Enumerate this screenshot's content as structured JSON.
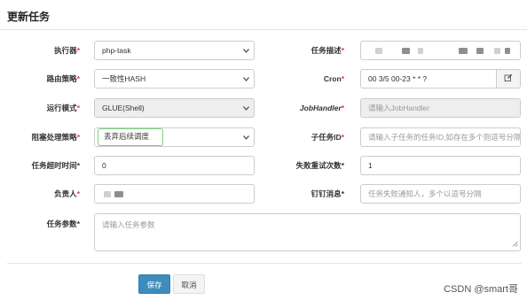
{
  "dialog": {
    "title": "更新任务"
  },
  "form": {
    "executor": {
      "label": "执行器",
      "value": "php-task"
    },
    "desc": {
      "label": "任务描述"
    },
    "route": {
      "label": "路由策略",
      "value": "一致性HASH"
    },
    "cron": {
      "label": "Cron",
      "value": "00 3/5 00-23 * * ?"
    },
    "run_mode": {
      "label": "运行模式",
      "value": "GLUE(Shell)"
    },
    "job_handler": {
      "label": "JobHandler",
      "placeholder": "请输入JobHandler"
    },
    "block_strategy": {
      "label": "阻塞处理策略",
      "value": "丢弃后续调度"
    },
    "child_job": {
      "label": "子任务ID",
      "placeholder": "请输入子任务的任务ID,如存在多个则逗号分隔"
    },
    "timeout": {
      "label": "任务超时时间",
      "value": "0"
    },
    "retry": {
      "label": "失败重试次数",
      "value": "1"
    },
    "owner": {
      "label": "负责人"
    },
    "dingtalk": {
      "label": "钉钉消息",
      "placeholder": "任务失败通知人，多个以逗号分隔"
    },
    "params": {
      "label": "任务参数",
      "placeholder": "请输入任务参数"
    }
  },
  "buttons": {
    "save": "保存",
    "cancel": "取消"
  },
  "watermark": "CSDN @smart哥"
}
